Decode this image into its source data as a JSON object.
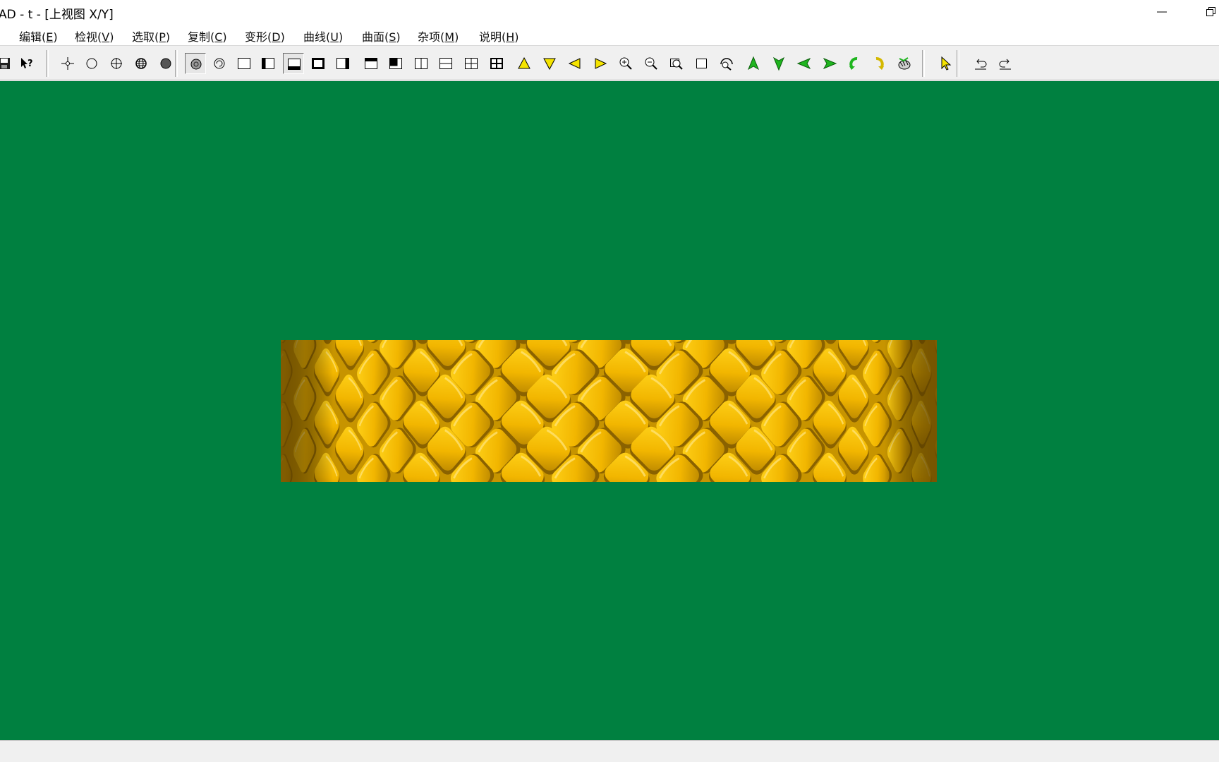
{
  "window": {
    "title": "AD - t - [上视图 X/Y]"
  },
  "menu": [
    {
      "id": "file",
      "label": ")",
      "hotkey": ""
    },
    {
      "id": "edit",
      "label": "编辑(",
      "hotkey": "E",
      "tail": ")"
    },
    {
      "id": "view",
      "label": "检视(",
      "hotkey": "V",
      "tail": ")"
    },
    {
      "id": "select",
      "label": "选取(",
      "hotkey": "P",
      "tail": ")"
    },
    {
      "id": "copy",
      "label": "复制(",
      "hotkey": "C",
      "tail": ")"
    },
    {
      "id": "transform",
      "label": "变形(",
      "hotkey": "D",
      "tail": ")"
    },
    {
      "id": "curve",
      "label": "曲线(",
      "hotkey": "U",
      "tail": ")"
    },
    {
      "id": "surface",
      "label": "曲面(",
      "hotkey": "S",
      "tail": ")"
    },
    {
      "id": "misc",
      "label": "杂项(",
      "hotkey": "M",
      "tail": ")"
    },
    {
      "id": "help",
      "label": "说明(",
      "hotkey": "H",
      "tail": ")"
    }
  ],
  "toolbar": {
    "buttons": [
      "save-icon",
      "context-help-icon",
      "snap-point-icon",
      "circle-icon",
      "crosshair-circle-icon",
      "sphere-grid-icon",
      "filled-circle-icon",
      "shaded-circle-icon",
      "rotate-circle-icon",
      "single-view-icon",
      "left-panel-view-icon",
      "bottom-panel-view-icon",
      "bold-frame-view-icon",
      "right-panel-view-icon",
      "top-panel-view-icon",
      "corner-panel-view-icon",
      "split-vertical-icon",
      "split-horizontal-icon",
      "four-views-icon",
      "four-views-bold-icon",
      "arrow-up-yellow-icon",
      "arrow-down-yellow-icon",
      "arrow-left-yellow-icon",
      "arrow-right-yellow-icon",
      "zoom-in-icon",
      "zoom-out-icon",
      "zoom-window-icon",
      "zoom-box-icon",
      "zoom-all-icon",
      "arrow-up-green-icon",
      "arrow-down-green-icon",
      "arrow-left-green-icon",
      "arrow-right-green-icon",
      "rotate-left-icon",
      "rotate-right-icon",
      "render-icon",
      "select-pointer-icon",
      "undo-icon",
      "redo-icon"
    ],
    "pressed": [
      "shaded-circle-icon",
      "bottom-panel-view-icon"
    ]
  },
  "viewport": {
    "background": "#008040",
    "object_color": "#f2b900",
    "object_shadow": "#8a6200"
  },
  "statusbar": {
    "text": ""
  }
}
